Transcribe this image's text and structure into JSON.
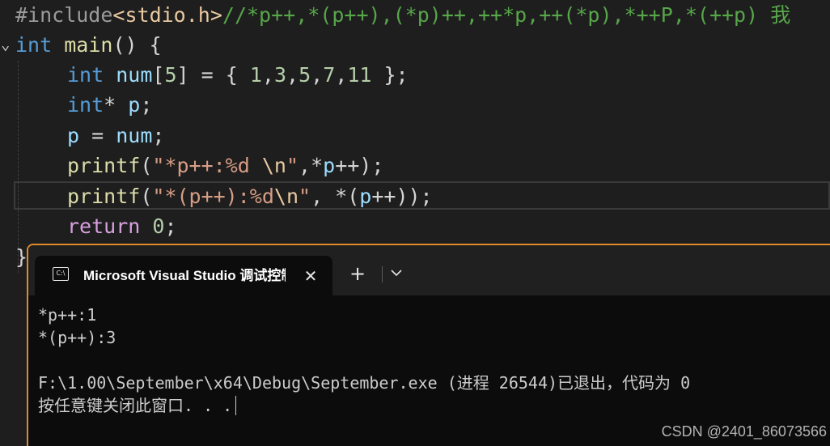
{
  "editor": {
    "lines": [
      {
        "tokens": [
          {
            "t": "#include",
            "c": "pre"
          },
          {
            "t": "<stdio.h>",
            "c": "inc"
          },
          {
            "t": "//*p++,*(p++),(*p)++,++*p,++(*p),*++P,*(++p) 我",
            "c": "com"
          }
        ]
      },
      {
        "tokens": [
          {
            "t": "int",
            "c": "kw"
          },
          {
            "t": " ",
            "c": "pun"
          },
          {
            "t": "main",
            "c": "fn"
          },
          {
            "t": "() {",
            "c": "pun"
          }
        ]
      },
      {
        "tokens": [
          {
            "t": "int",
            "c": "kw"
          },
          {
            "t": " ",
            "c": "pun"
          },
          {
            "t": "num",
            "c": "var"
          },
          {
            "t": "[",
            "c": "pun"
          },
          {
            "t": "5",
            "c": "num"
          },
          {
            "t": "] = { ",
            "c": "pun"
          },
          {
            "t": "1",
            "c": "num"
          },
          {
            "t": ",",
            "c": "pun"
          },
          {
            "t": "3",
            "c": "num"
          },
          {
            "t": ",",
            "c": "pun"
          },
          {
            "t": "5",
            "c": "num"
          },
          {
            "t": ",",
            "c": "pun"
          },
          {
            "t": "7",
            "c": "num"
          },
          {
            "t": ",",
            "c": "pun"
          },
          {
            "t": "11",
            "c": "num"
          },
          {
            "t": " };",
            "c": "pun"
          }
        ]
      },
      {
        "tokens": [
          {
            "t": "int",
            "c": "kw"
          },
          {
            "t": "* ",
            "c": "pun"
          },
          {
            "t": "p",
            "c": "var"
          },
          {
            "t": ";",
            "c": "pun"
          }
        ]
      },
      {
        "tokens": [
          {
            "t": "p",
            "c": "var"
          },
          {
            "t": " = ",
            "c": "pun"
          },
          {
            "t": "num",
            "c": "var"
          },
          {
            "t": ";",
            "c": "pun"
          }
        ]
      },
      {
        "tokens": [
          {
            "t": "printf",
            "c": "fn"
          },
          {
            "t": "(",
            "c": "pun"
          },
          {
            "t": "\"*p++:%d ",
            "c": "str"
          },
          {
            "t": "\\n",
            "c": "esc"
          },
          {
            "t": "\"",
            "c": "str"
          },
          {
            "t": ",*",
            "c": "pun"
          },
          {
            "t": "p",
            "c": "var"
          },
          {
            "t": "++);",
            "c": "pun"
          }
        ]
      },
      {
        "tokens": [
          {
            "t": "printf",
            "c": "fn"
          },
          {
            "t": "(",
            "c": "pun"
          },
          {
            "t": "\"*(p++):%d",
            "c": "str"
          },
          {
            "t": "\\n",
            "c": "esc"
          },
          {
            "t": "\"",
            "c": "str"
          },
          {
            "t": ", *(",
            "c": "pun"
          },
          {
            "t": "p",
            "c": "var"
          },
          {
            "t": "++));",
            "c": "pun"
          }
        ]
      },
      {
        "tokens": [
          {
            "t": "return",
            "c": "ctl"
          },
          {
            "t": " ",
            "c": "pun"
          },
          {
            "t": "0",
            "c": "num"
          },
          {
            "t": ";",
            "c": "pun"
          }
        ]
      },
      {
        "tokens": [
          {
            "t": "}",
            "c": "pun"
          }
        ]
      }
    ]
  },
  "terminal": {
    "icon_text": "C:\\",
    "tab_title": "Microsoft Visual Studio 调试控制台",
    "close_glyph": "✕",
    "new_tab_glyph": "+",
    "output": [
      "*p++:1",
      "*(p++):3",
      "",
      "F:\\1.00\\September\\x64\\Debug\\September.exe (进程 26544)已退出，代码为 0",
      "按任意键关闭此窗口. . ."
    ]
  },
  "watermark": "CSDN @2401_86073566",
  "colors": {
    "editor_bg": "#1e1e1e",
    "terminal_bg": "#0c0c0c",
    "terminal_border": "#e08a2c",
    "keyword": "#569cd6",
    "string": "#d69d85",
    "comment": "#57a64a"
  }
}
